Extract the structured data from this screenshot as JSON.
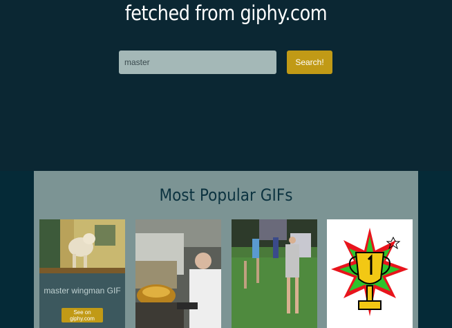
{
  "header": {
    "title": "fetched from giphy.com"
  },
  "search": {
    "value": "master",
    "button_label": "Search!"
  },
  "section": {
    "title": "Most Popular GIFs"
  },
  "cards": [
    {
      "caption": "master wingman GIF",
      "link_label": "See on giphy.com"
    }
  ]
}
